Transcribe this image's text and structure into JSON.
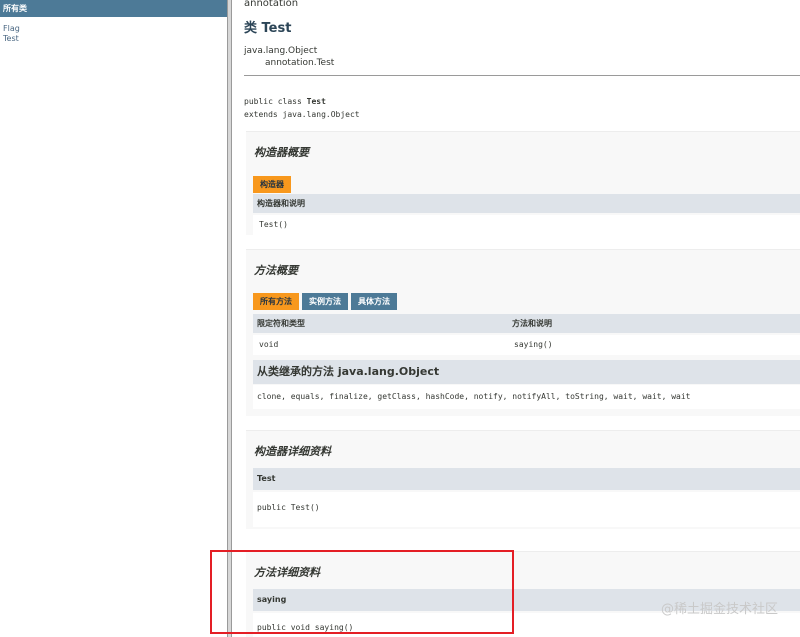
{
  "left_panel": {
    "header": "所有类",
    "classes": [
      "Flag",
      "Test"
    ]
  },
  "main": {
    "package_name": "annotation",
    "class_title": "类 Test",
    "inheritance": [
      "java.lang.Object",
      "annotation.Test"
    ],
    "declaration": {
      "line1_prefix": "public class ",
      "line1_name": "Test",
      "line2": "extends java.lang.Object"
    },
    "constructor_summary": {
      "title": "构造器概要",
      "tab": "构造器",
      "column_header": "构造器和说明",
      "rows": [
        "Test()"
      ]
    },
    "method_summary": {
      "title": "方法概要",
      "tabs": [
        "所有方法",
        "实例方法",
        "具体方法"
      ],
      "col_modifier": "限定符和类型",
      "col_method": "方法和说明",
      "rows": [
        {
          "modifier": "void",
          "method": "saying()"
        }
      ],
      "inherited_title": "从类继承的方法 java.lang.Object",
      "inherited_list": "clone, equals, finalize, getClass, hashCode, notify, notifyAll, toString, wait, wait, wait"
    },
    "constructor_detail": {
      "title": "构造器详细资料",
      "name": "Test",
      "signature": "public  Test()"
    },
    "method_detail": {
      "title": "方法详细资料",
      "name": "saying",
      "signature": "public  void  saying()"
    }
  },
  "watermark": "@稀土掘金技术社区",
  "colors": {
    "nav_blue": "#4d7a97",
    "tab_orange": "#f8981d",
    "header_gray": "#dee3e9",
    "highlight_red": "#e41e25"
  }
}
